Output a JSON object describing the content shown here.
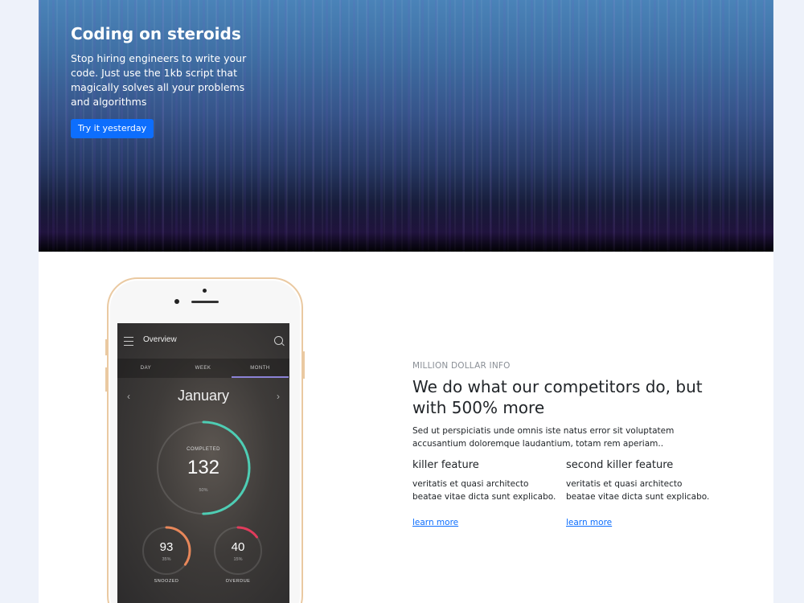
{
  "hero": {
    "title": "Coding on steroids",
    "text": "Stop hiring engineers to write your code. Just use the 1kb script that magically solves all your problems and algorithms",
    "button_label": "Try it yesterday"
  },
  "phone_app": {
    "title": "Overview",
    "tabs": [
      "DAY",
      "WEEK",
      "MONTH"
    ],
    "active_tab": "MONTH",
    "month": "January",
    "completed": {
      "label": "COMPLETED",
      "value": "132",
      "percent": "50%",
      "fraction": 0.5,
      "color": "#4ecdb4"
    },
    "snoozed": {
      "label": "SNOOZED",
      "value": "93",
      "percent": "35%",
      "fraction": 0.35,
      "color": "#e8875a"
    },
    "overdue": {
      "label": "OVERDUE",
      "value": "40",
      "percent": "15%",
      "fraction": 0.15,
      "color": "#e03c5c"
    }
  },
  "feature": {
    "eyebrow": "MILLION DOLLAR INFO",
    "heading": "We do what our competitors do, but with 500% more",
    "lead": "Sed ut perspiciatis unde omnis iste natus error sit voluptatem accusantium doloremque laudantium, totam rem aperiam..",
    "columns": [
      {
        "title": "killer feature",
        "text": "veritatis et quasi architecto beatae vitae dicta sunt explicabo.",
        "link": "learn more"
      },
      {
        "title": "second killer feature",
        "text": "veritatis et quasi architecto beatae vitae dicta sunt explicabo.",
        "link": "learn more"
      }
    ]
  },
  "colors": {
    "primary": "#0d6efd",
    "page_background": "#eef2fa",
    "tab_accent": "#8b82d6"
  }
}
